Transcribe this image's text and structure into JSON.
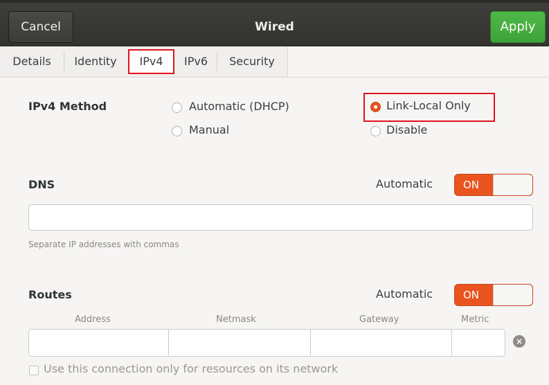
{
  "header": {
    "title": "Wired",
    "cancel_label": "Cancel",
    "apply_label": "Apply"
  },
  "tabs": [
    {
      "label": "Details",
      "active": false
    },
    {
      "label": "Identity",
      "active": false
    },
    {
      "label": "IPv4",
      "active": true
    },
    {
      "label": "IPv6",
      "active": false
    },
    {
      "label": "Security",
      "active": false
    }
  ],
  "ipv4_method": {
    "label": "IPv4 Method",
    "options": [
      {
        "label": "Automatic (DHCP)",
        "selected": false
      },
      {
        "label": "Link-Local Only",
        "selected": true
      },
      {
        "label": "Manual",
        "selected": false
      },
      {
        "label": "Disable",
        "selected": false
      }
    ]
  },
  "dns": {
    "label": "DNS",
    "automatic_label": "Automatic",
    "switch_text": "ON",
    "switch_on": true,
    "input_value": "",
    "hint": "Separate IP addresses with commas"
  },
  "routes": {
    "label": "Routes",
    "automatic_label": "Automatic",
    "switch_text": "ON",
    "switch_on": true,
    "columns": [
      "Address",
      "Netmask",
      "Gateway",
      "Metric"
    ],
    "row": [
      "",
      "",
      "",
      ""
    ]
  },
  "only_local_checkbox": {
    "label": "Use this connection only for resources on its network",
    "checked": false
  },
  "colors": {
    "accent": "#e95420",
    "apply_green": "#3fa33a",
    "highlight_red": "#e0121f"
  }
}
